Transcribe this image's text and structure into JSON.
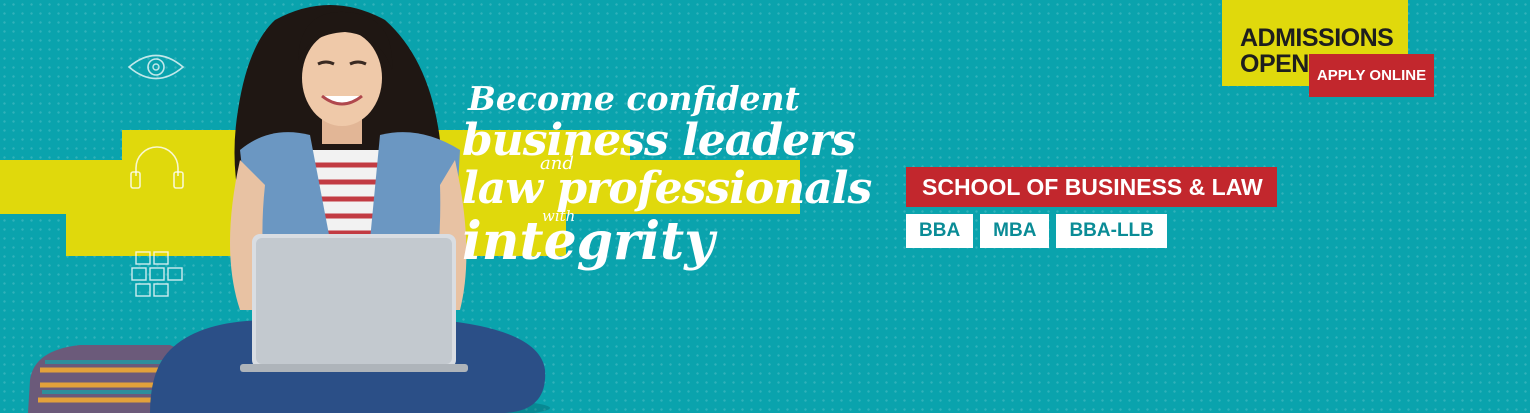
{
  "colors": {
    "background": "#0aa3ad",
    "accent_yellow": "#e0d90c",
    "accent_red": "#c2272d",
    "text_white": "#ffffff",
    "program_text": "#0a8c96"
  },
  "headline": {
    "line1": "Become confident",
    "line2": "business leaders",
    "line3": "and",
    "line4": "law professionals",
    "line5": "with",
    "line6": "integrity"
  },
  "school": {
    "title": "SCHOOL OF BUSINESS & LAW",
    "programs": [
      "BBA",
      "MBA",
      "BBA-LLB"
    ]
  },
  "admissions": {
    "line1": "ADMISSIONS",
    "line2": "OPEN",
    "apply_label": "APPLY ONLINE"
  },
  "icons": [
    "eye-icon",
    "headphones-icon",
    "blocks-icon"
  ]
}
